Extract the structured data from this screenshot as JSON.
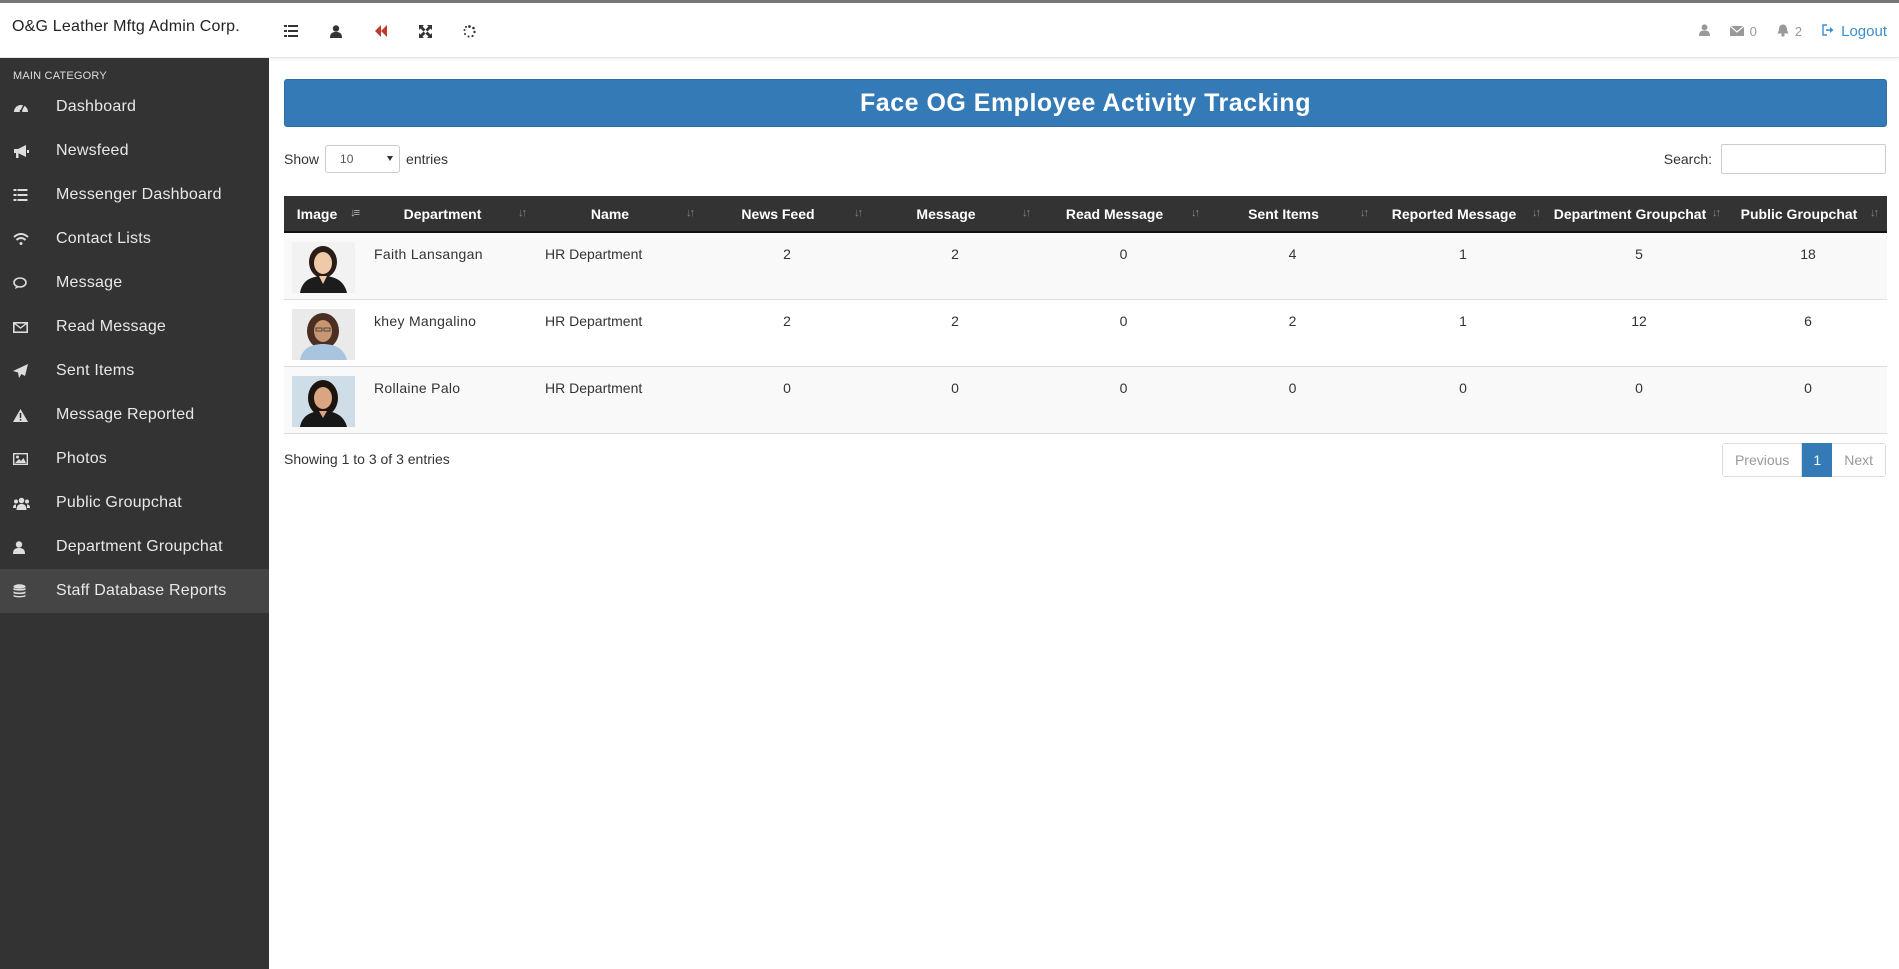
{
  "topbar": {
    "brand": "O&G Leather Mftg Admin Corp.",
    "mail_count": "0",
    "bell_count": "2",
    "logout": "Logout"
  },
  "sidebar": {
    "category": "MAIN CATEGORY",
    "items": [
      {
        "label": "Dashboard",
        "icon": "dashboard-icon"
      },
      {
        "label": "Newsfeed",
        "icon": "bullhorn-icon"
      },
      {
        "label": "Messenger Dashboard",
        "icon": "list-icon"
      },
      {
        "label": "Contact Lists",
        "icon": "wifi-icon"
      },
      {
        "label": "Message",
        "icon": "comments-icon"
      },
      {
        "label": "Read Message",
        "icon": "envelope-icon"
      },
      {
        "label": "Sent Items",
        "icon": "paper-plane-icon"
      },
      {
        "label": "Message Reported",
        "icon": "warning-icon"
      },
      {
        "label": "Photos",
        "icon": "image-icon"
      },
      {
        "label": "Public Groupchat",
        "icon": "users-icon"
      },
      {
        "label": "Department Groupchat",
        "icon": "user-icon"
      },
      {
        "label": "Staff Database Reports",
        "icon": "database-icon",
        "active": true
      }
    ]
  },
  "panel": {
    "title": "Face OG Employee Activity Tracking"
  },
  "controls": {
    "show": "Show",
    "entries_value": "10",
    "entries": "entries",
    "search": "Search:",
    "search_value": ""
  },
  "table": {
    "headers": [
      "Image",
      "Department",
      "Name",
      "News Feed",
      "Message",
      "Read Message",
      "Sent Items",
      "Reported Message",
      "Department Groupchat",
      "Public Groupchat"
    ],
    "rows": [
      {
        "name": "Faith  Lansangan",
        "department": "HR Department",
        "news_feed": "2",
        "message": "2",
        "read_message": "0",
        "sent_items": "4",
        "reported_message": "1",
        "department_groupchat": "5",
        "public_groupchat": "18"
      },
      {
        "name": "khey  Mangalino",
        "department": "HR Department",
        "news_feed": "2",
        "message": "2",
        "read_message": "0",
        "sent_items": "2",
        "reported_message": "1",
        "department_groupchat": "12",
        "public_groupchat": "6"
      },
      {
        "name": "Rollaine  Palo",
        "department": "HR Department",
        "news_feed": "0",
        "message": "0",
        "read_message": "0",
        "sent_items": "0",
        "reported_message": "0",
        "department_groupchat": "0",
        "public_groupchat": "0"
      }
    ]
  },
  "footer": {
    "info": "Showing 1 to 3 of 3 entries",
    "previous": "Previous",
    "current_page": "1",
    "next": "Next"
  },
  "colors": {
    "sidebar_bg": "#333333",
    "accent": "#337ab7",
    "back_icon": "#c0392b"
  }
}
